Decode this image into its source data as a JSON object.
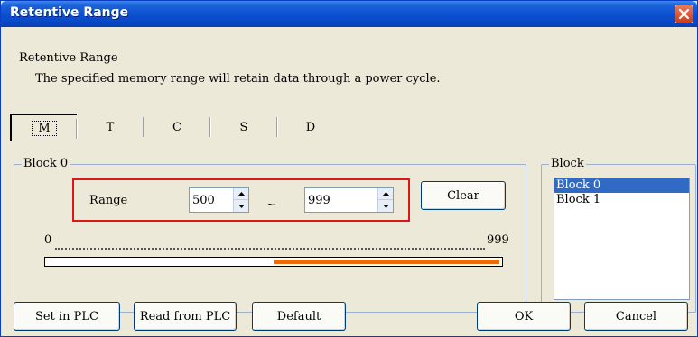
{
  "window": {
    "title": "Retentive Range"
  },
  "header": {
    "label": "Retentive Range",
    "description": "The specified memory range will retain data through a power cycle."
  },
  "tabs": [
    {
      "label": "M",
      "active": true
    },
    {
      "label": "T",
      "active": false
    },
    {
      "label": "C",
      "active": false
    },
    {
      "label": "S",
      "active": false
    },
    {
      "label": "D",
      "active": false
    }
  ],
  "block_group": {
    "legend": "Block 0",
    "range_label": "Range",
    "range_start": "500",
    "range_end": "999",
    "separator": "~",
    "clear_label": "Clear",
    "scale_min": "0",
    "scale_max": "999",
    "range_fill": {
      "start_fraction": 0.5,
      "end_fraction": 0.999
    },
    "fill_color": "#e96b0c"
  },
  "block_list": {
    "legend": "Block",
    "items": [
      "Block 0",
      "Block 1"
    ],
    "selected": "Block 0"
  },
  "buttons": {
    "set_in_plc": "Set in PLC",
    "read_from_plc": "Read from PLC",
    "default": "Default",
    "ok": "OK",
    "cancel": "Cancel"
  },
  "icons": {
    "close": "close-icon",
    "spin_up": "spin-up-icon",
    "spin_down": "spin-down-icon"
  }
}
